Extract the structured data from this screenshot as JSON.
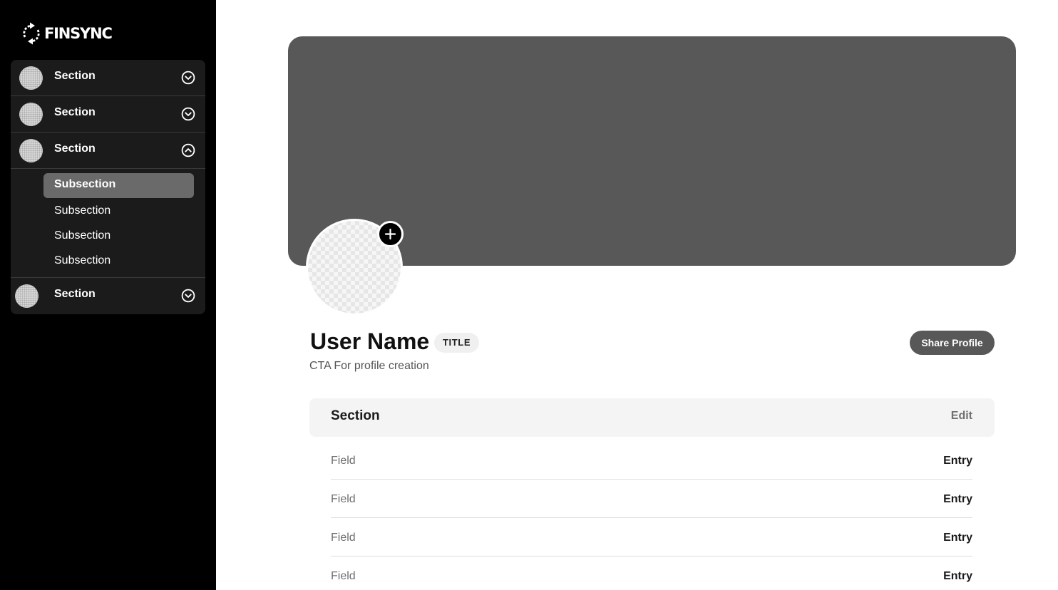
{
  "brand": {
    "name": "FINSYNC"
  },
  "sidebar": {
    "sections": [
      {
        "label": "Section",
        "expanded": false
      },
      {
        "label": "Section",
        "expanded": false
      },
      {
        "label": "Section",
        "expanded": true,
        "subsections": [
          {
            "label": "Subsection",
            "active": true
          },
          {
            "label": "Subsection",
            "active": false
          },
          {
            "label": "Subsection",
            "active": false
          },
          {
            "label": "Subsection",
            "active": false
          }
        ]
      },
      {
        "label": "Section",
        "expanded": false
      }
    ]
  },
  "profile": {
    "user_name": "User Name",
    "title_badge": "TITLE",
    "cta": "CTA For profile creation",
    "share_label": "Share Profile"
  },
  "details": {
    "section_title": "Section",
    "edit_label": "Edit",
    "rows": [
      {
        "field": "Field",
        "entry": "Entry"
      },
      {
        "field": "Field",
        "entry": "Entry"
      },
      {
        "field": "Field",
        "entry": "Entry"
      },
      {
        "field": "Field",
        "entry": "Entry"
      }
    ]
  },
  "icons": {
    "logo": "sync-arrows-icon",
    "collapsed": "chevron-down-circle-icon",
    "expanded": "chevron-up-circle-icon",
    "add_photo": "plus-icon"
  },
  "colors": {
    "sidebar_bg": "#000000",
    "nav_bg": "#1b1b1b",
    "active_subsection": "#6a6a6a",
    "cover": "#585858",
    "share_button": "#585858",
    "section_header_bg": "#f4f4f4"
  }
}
